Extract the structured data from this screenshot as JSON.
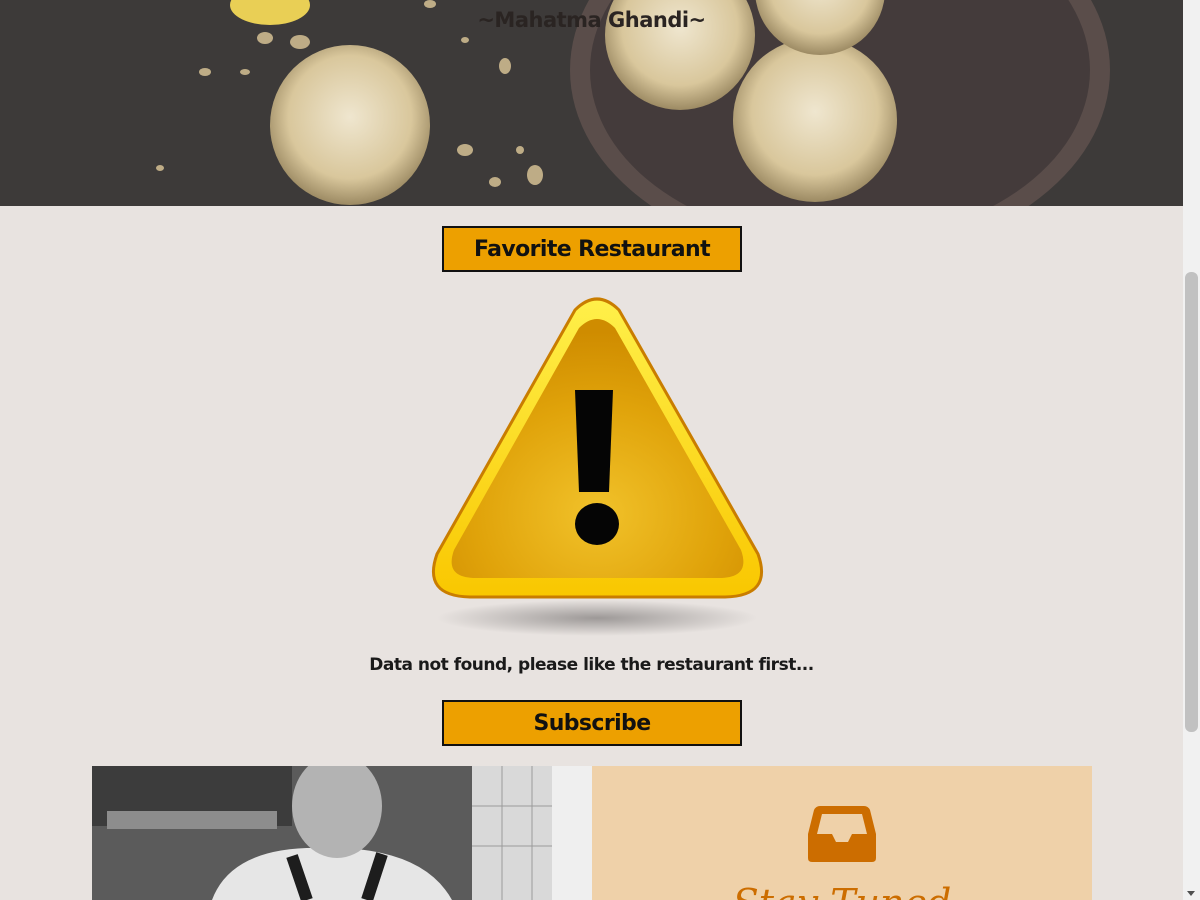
{
  "hero": {
    "quote_attribution": "~Mahatma Ghandi~"
  },
  "favorite_button_label": "Favorite Restaurant",
  "empty_state": {
    "icon": "warning-icon",
    "message": "Data not found, please like the restaurant first..."
  },
  "subscribe_button_label": "Subscribe",
  "promo": {
    "icon": "inbox-icon",
    "title": "Stay Tuned"
  },
  "colors": {
    "accent": "#eda000",
    "page_background": "#e8e3e0",
    "promo_background": "#efd1a9",
    "promo_accent": "#cc6d00"
  }
}
